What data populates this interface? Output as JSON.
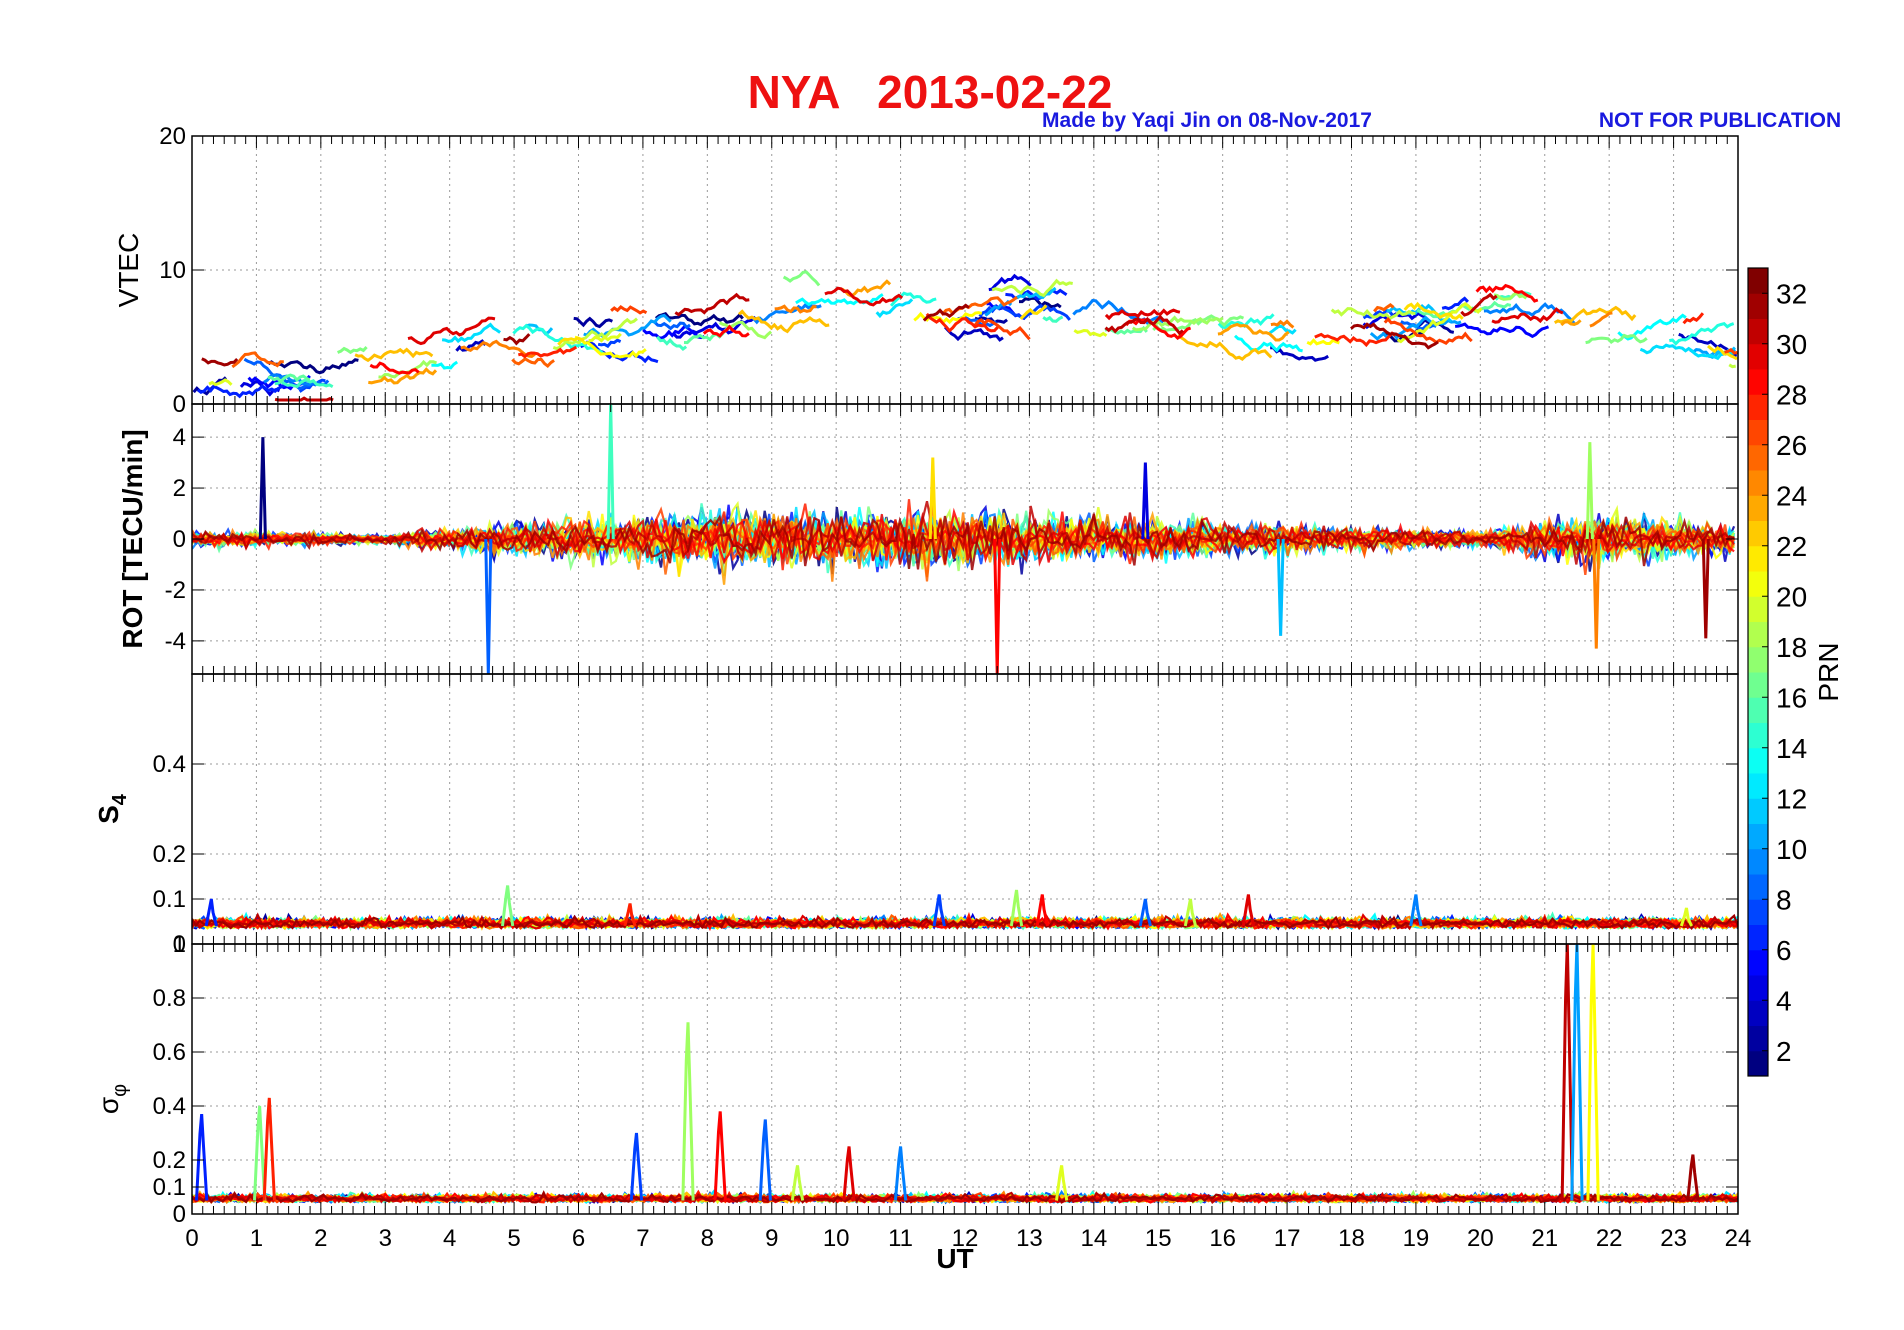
{
  "header": {
    "title": "NYA   2013-02-22",
    "credit": "Made by Yaqi Jin on 08-Nov-2017",
    "notice": "NOT FOR PUBLICATION",
    "title_color": "#ee1111",
    "credit_color": "#1a1adf"
  },
  "colorbar": {
    "label": "PRN",
    "ticks": [
      "2",
      "4",
      "6",
      "8",
      "10",
      "12",
      "14",
      "16",
      "18",
      "20",
      "22",
      "24",
      "26",
      "28",
      "30",
      "32"
    ],
    "range": [
      1,
      33
    ],
    "colormap": "jet"
  },
  "chart_data": [
    {
      "type": "line",
      "panel": "vtec",
      "ylabel": "VTEC",
      "xlim": [
        0,
        24
      ],
      "ylim": [
        0,
        20
      ],
      "yticks": [
        "0",
        "10",
        "20"
      ],
      "grid": true,
      "series_colored_by": "PRN",
      "activity": [
        [
          0,
          2
        ],
        [
          1,
          1.5
        ],
        [
          2,
          2.5
        ],
        [
          3,
          3
        ],
        [
          4,
          3.5
        ],
        [
          5,
          4.5
        ],
        [
          6,
          5
        ],
        [
          7,
          6.5
        ],
        [
          8,
          6
        ],
        [
          9,
          8
        ],
        [
          10,
          8
        ],
        [
          11,
          7.5
        ],
        [
          12,
          7
        ],
        [
          13,
          7
        ],
        [
          14,
          6.5
        ],
        [
          15,
          6
        ],
        [
          16,
          6
        ],
        [
          17,
          5.5
        ],
        [
          18,
          6
        ],
        [
          19,
          6
        ],
        [
          20,
          7
        ],
        [
          21,
          6
        ],
        [
          22,
          5
        ],
        [
          23,
          5
        ],
        [
          24,
          2
        ]
      ]
    },
    {
      "type": "line",
      "panel": "rot",
      "ylabel": "ROT [TECU/min]",
      "xlim": [
        0,
        24
      ],
      "ylim": [
        -5.3,
        5.3
      ],
      "yticks": [
        "-4",
        "-2",
        "0",
        "2",
        "4"
      ],
      "grid": true,
      "series_colored_by": "PRN",
      "activity": [
        [
          0,
          0.5
        ],
        [
          3,
          0.3
        ],
        [
          4.5,
          0.8
        ],
        [
          6,
          1.2
        ],
        [
          8,
          1.8
        ],
        [
          10,
          1.6
        ],
        [
          12,
          1.8
        ],
        [
          14,
          1.3
        ],
        [
          16,
          1.0
        ],
        [
          18,
          0.7
        ],
        [
          20,
          0.5
        ],
        [
          21.5,
          1.4
        ],
        [
          23,
          1.2
        ],
        [
          24,
          0.8
        ]
      ],
      "spikes": [
        [
          1.1,
          4.0
        ],
        [
          4.6,
          -5.3
        ],
        [
          6.5,
          5.3
        ],
        [
          11.5,
          3.2
        ],
        [
          12.5,
          -5.3
        ],
        [
          14.8,
          3.0
        ],
        [
          16.9,
          -3.8
        ],
        [
          21.7,
          3.8
        ],
        [
          21.8,
          -4.3
        ],
        [
          23.5,
          -3.9
        ]
      ]
    },
    {
      "type": "line",
      "panel": "s4",
      "ylabel": "S4",
      "xlim": [
        0,
        24
      ],
      "ylim": [
        0,
        0.6
      ],
      "yticks": [
        "0",
        "0.1",
        "0.2",
        "0.4"
      ],
      "grid": true,
      "series_colored_by": "PRN",
      "baseline": 0.04,
      "spikes": [
        [
          0.3,
          0.1
        ],
        [
          4.9,
          0.13
        ],
        [
          6.8,
          0.09
        ],
        [
          11.6,
          0.11
        ],
        [
          12.8,
          0.12
        ],
        [
          13.2,
          0.11
        ],
        [
          14.8,
          0.1
        ],
        [
          15.5,
          0.1
        ],
        [
          16.4,
          0.11
        ],
        [
          19,
          0.11
        ],
        [
          23.2,
          0.08
        ]
      ]
    },
    {
      "type": "line",
      "panel": "sigma-phi",
      "ylabel": "σφ",
      "xlabel": "UT",
      "xlim": [
        0,
        24
      ],
      "ylim": [
        0,
        1
      ],
      "yticks": [
        "0",
        "0.1",
        "0.2",
        "0.4",
        "0.6",
        "0.8",
        "1"
      ],
      "xticks": [
        "0",
        "1",
        "2",
        "3",
        "4",
        "5",
        "6",
        "7",
        "8",
        "9",
        "10",
        "11",
        "12",
        "13",
        "14",
        "15",
        "16",
        "17",
        "18",
        "19",
        "20",
        "21",
        "22",
        "23",
        "24"
      ],
      "grid": true,
      "series_colored_by": "PRN",
      "baseline": 0.05,
      "spikes": [
        [
          0.15,
          0.37
        ],
        [
          1.05,
          0.4
        ],
        [
          1.2,
          0.43
        ],
        [
          6.9,
          0.3
        ],
        [
          7.7,
          0.71
        ],
        [
          8.2,
          0.38
        ],
        [
          8.9,
          0.35
        ],
        [
          9.4,
          0.18
        ],
        [
          10.2,
          0.25
        ],
        [
          11.0,
          0.25
        ],
        [
          13.5,
          0.18
        ],
        [
          21.35,
          1.0
        ],
        [
          21.5,
          1.0
        ],
        [
          21.75,
          1.0
        ],
        [
          23.3,
          0.22
        ]
      ]
    }
  ]
}
